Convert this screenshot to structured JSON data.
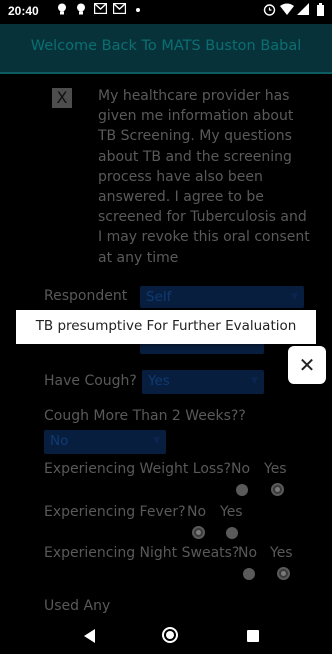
{
  "status_bar": {
    "time": "20:40",
    "left_icons": [
      "bulb-icon",
      "bulb-icon",
      "gmail-icon",
      "gmail-icon",
      "dot-icon"
    ],
    "right_icons": [
      "alarm-icon",
      "wifi-icon",
      "signal-icon",
      "battery-icon"
    ]
  },
  "app_bar": {
    "title": "Welcome Back To MATS Buston Babal"
  },
  "consent": {
    "checkbox_mark": "X",
    "text": "My healthcare provider has given me information about TB Screening. My questions about TB and the screening process have also been answered. I agree to be screened for Tuberculosis and I may revoke this oral consent at any time"
  },
  "form": {
    "respondent": {
      "label": "Respondent",
      "value": "Self"
    },
    "have_cough": {
      "label": "Have Cough?",
      "value": "Yes"
    },
    "cough_2_weeks": {
      "label": "Cough More Than 2 Weeks??",
      "value": "No"
    },
    "weight_loss": {
      "label": "Experiencing Weight Loss?",
      "options": [
        "No",
        "Yes"
      ],
      "selected": "Yes"
    },
    "fever": {
      "label": "Experiencing Fever?",
      "options": [
        "No",
        "Yes"
      ],
      "selected": "No"
    },
    "night_sweats": {
      "label": "Experiencing Night Sweats?",
      "options": [
        "No",
        "Yes"
      ],
      "selected": "Yes"
    },
    "used_any": {
      "label": "Used Any"
    }
  },
  "toast": {
    "message": "TB presumptive For Further Evaluation",
    "close_symbol": "✕"
  },
  "colors": {
    "app_bar_bg": "#08323a",
    "app_bar_title": "#0a6f72",
    "select_bg": "#081e3e",
    "toast_bg": "#ffffff"
  }
}
